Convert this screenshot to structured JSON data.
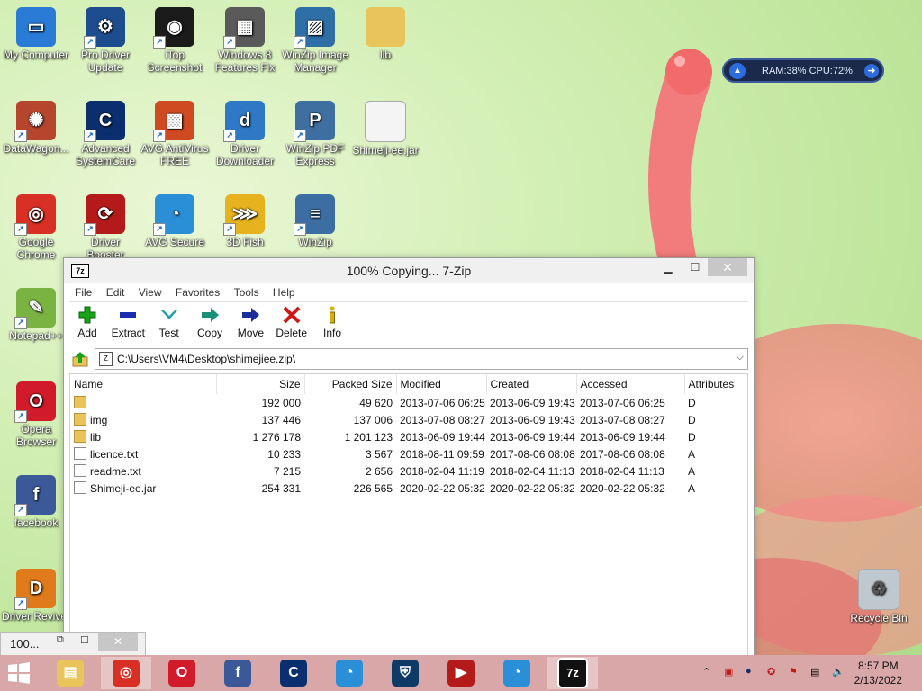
{
  "desktop": {
    "icons": [
      {
        "label": "My Computer",
        "icon": "computer-icon",
        "color": "#2a7bd5"
      },
      {
        "label": "Pro Driver Update",
        "icon": "pro-driver-icon",
        "color": "#1e4d8f"
      },
      {
        "label": "iTop Screenshot",
        "icon": "camera-icon",
        "color": "#1b1b1b"
      },
      {
        "label": "Windows 8 Features Fix",
        "icon": "installer-icon",
        "color": "#5a5a5a"
      },
      {
        "label": "WinZip Image Manager",
        "icon": "image-icon",
        "color": "#2f6fa8"
      },
      {
        "label": "lib",
        "icon": "folder-icon",
        "color": "#e8c45a"
      },
      {
        "label": "DataWagon...",
        "icon": "datawagon-icon",
        "color": "#b5452c"
      },
      {
        "label": "Advanced SystemCare",
        "icon": "systemcare-icon",
        "color": "#0a2e6e"
      },
      {
        "label": "AVG AntiVirus FREE",
        "icon": "avg-icon",
        "color": "#d04a21"
      },
      {
        "label": "Driver Downloader",
        "icon": "driver-downloader-icon",
        "color": "#2f78c6"
      },
      {
        "label": "WinZip PDF Express",
        "icon": "pdf-icon",
        "color": "#3f6fa0"
      },
      {
        "label": "Shimeji-ee.jar",
        "icon": "file-icon",
        "color": "#f4f4f4"
      },
      {
        "label": "Google Chrome",
        "icon": "chrome-icon",
        "color": "#d93025"
      },
      {
        "label": "Driver Booster",
        "icon": "driver-booster-icon",
        "color": "#b51a1a"
      },
      {
        "label": "AVG Secure",
        "icon": "avg-secure-icon",
        "color": "#2b8fd8"
      },
      {
        "label": "3D Fish",
        "icon": "fish-icon",
        "color": "#e6b21d"
      },
      {
        "label": "WinZip",
        "icon": "winzip-icon",
        "color": "#3c6ea3"
      },
      {
        "label": "Notepad++",
        "icon": "notepad-icon",
        "color": "#7bb342"
      },
      {
        "label": "Opera Browser",
        "icon": "opera-icon",
        "color": "#d11a2a"
      },
      {
        "label": "facebook",
        "icon": "facebook-icon",
        "color": "#3b5998"
      },
      {
        "label": "Driver Reviver",
        "icon": "driver-reviver-icon",
        "color": "#e07a1a"
      },
      {
        "label": "Recycle Bin",
        "icon": "recycle-bin-icon",
        "color": "#bfc7cf"
      }
    ]
  },
  "widget": {
    "text": "RAM:38%  CPU:72%"
  },
  "window": {
    "title": "100% Copying... 7-Zip",
    "min": "▁",
    "max": "☐",
    "close": "✕",
    "app_icon": "7z",
    "menu": [
      "File",
      "Edit",
      "View",
      "Favorites",
      "Tools",
      "Help"
    ],
    "toolbar": [
      {
        "label": "Add",
        "icon": "add-icon",
        "color": "#18a318"
      },
      {
        "label": "Extract",
        "icon": "extract-icon",
        "color": "#1a2fb0"
      },
      {
        "label": "Test",
        "icon": "test-icon",
        "color": "#1aa3a3"
      },
      {
        "label": "Copy",
        "icon": "copy-icon",
        "color": "#1a8f7a"
      },
      {
        "label": "Move",
        "icon": "move-icon",
        "color": "#1a2f9a"
      },
      {
        "label": "Delete",
        "icon": "delete-icon",
        "color": "#d01818"
      },
      {
        "label": "Info",
        "icon": "info-icon",
        "color": "#d8b000"
      }
    ],
    "address": "C:\\Users\\VM4\\Desktop\\shimejiee.zip\\",
    "columns": [
      "Name",
      "Size",
      "Packed Size",
      "Modified",
      "Created",
      "Accessed",
      "Attributes"
    ],
    "rows": [
      {
        "type": "folder",
        "name": "",
        "size": "192 000",
        "packed": "49 620",
        "modified": "2013-07-06 06:25",
        "created": "2013-06-09 19:43",
        "accessed": "2013-07-06 06:25",
        "attr": "D"
      },
      {
        "type": "folder",
        "name": "img",
        "size": "137 446",
        "packed": "137 006",
        "modified": "2013-07-08 08:27",
        "created": "2013-06-09 19:43",
        "accessed": "2013-07-08 08:27",
        "attr": "D"
      },
      {
        "type": "folder",
        "name": "lib",
        "size": "1 276 178",
        "packed": "1 201 123",
        "modified": "2013-06-09 19:44",
        "created": "2013-06-09 19:44",
        "accessed": "2013-06-09 19:44",
        "attr": "D"
      },
      {
        "type": "file",
        "name": "licence.txt",
        "size": "10 233",
        "packed": "3 567",
        "modified": "2018-08-11 09:59",
        "created": "2017-08-06 08:08",
        "accessed": "2017-08-06 08:08",
        "attr": "A"
      },
      {
        "type": "file",
        "name": "readme.txt",
        "size": "7 215",
        "packed": "2 656",
        "modified": "2018-02-04 11:19",
        "created": "2018-02-04 11:13",
        "accessed": "2018-02-04 11:13",
        "attr": "A"
      },
      {
        "type": "file",
        "name": "Shimeji-ee.jar",
        "size": "254 331",
        "packed": "226 565",
        "modified": "2020-02-22 05:32",
        "created": "2020-02-22 05:32",
        "accessed": "2020-02-22 05:32",
        "attr": "A"
      }
    ]
  },
  "mini": {
    "text": "100...",
    "restore": "⧉",
    "max": "☐",
    "close": "✕"
  },
  "taskbar": {
    "time": "8:57 PM",
    "date": "2/13/2022",
    "color": "#d9a7a7",
    "apps": [
      "file-explorer-icon",
      "chrome-icon",
      "opera-icon",
      "facebook-icon",
      "systemcare-icon",
      "avg-secure-icon",
      "vpn-icon",
      "screen-recorder-icon",
      "avg-secure-icon",
      "7zip-icon"
    ],
    "app_label_7zip": "7z"
  }
}
